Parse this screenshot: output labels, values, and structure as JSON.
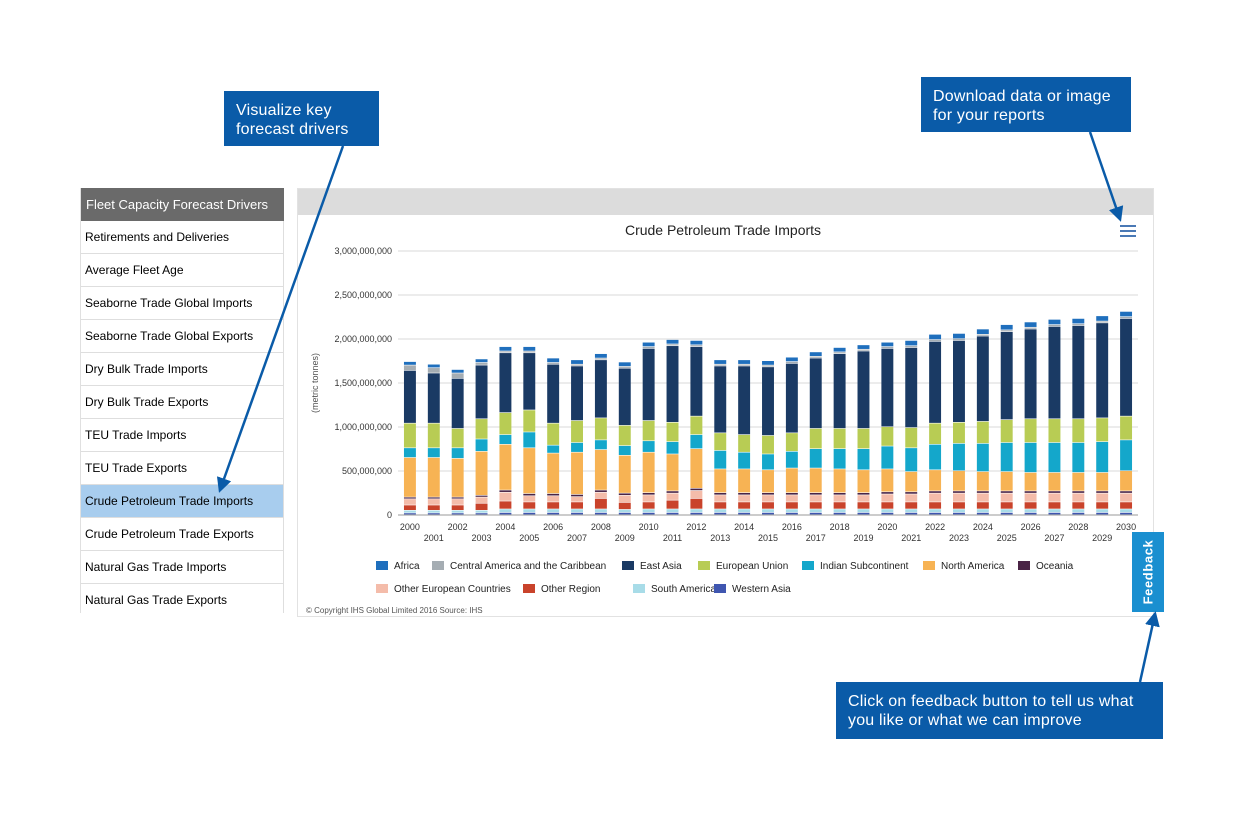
{
  "callouts": {
    "drivers": "Visualize key forecast drivers",
    "download": "Download data or image for your reports",
    "feedback": "Click on feedback button to tell us what you like or what we can improve"
  },
  "sidebar": {
    "header": "Fleet Capacity Forecast Drivers",
    "items": [
      {
        "label": "Retirements and Deliveries"
      },
      {
        "label": "Average Fleet Age"
      },
      {
        "label": "Seaborne Trade Global Imports"
      },
      {
        "label": "Seaborne Trade Global Exports"
      },
      {
        "label": "Dry Bulk Trade Imports"
      },
      {
        "label": "Dry Bulk Trade Exports"
      },
      {
        "label": "TEU Trade Imports"
      },
      {
        "label": "TEU Trade Exports"
      },
      {
        "label": "Crude Petroleum Trade Imports",
        "active": true
      },
      {
        "label": "Crude Petroleum Trade Exports"
      },
      {
        "label": "Natural Gas Trade Imports"
      },
      {
        "label": "Natural Gas Trade Exports"
      }
    ]
  },
  "chart": {
    "menu_icon": "hamburger-menu-icon",
    "copyright": "© Copyright IHS Global Limited 2016     Source: IHS"
  },
  "feedback": {
    "label": "Feedback"
  },
  "chart_data": {
    "type": "bar",
    "stacked": true,
    "title": "Crude Petroleum Trade Imports",
    "xlabel": "",
    "ylabel": "(metric tonnes)",
    "ylim": [
      0,
      3000000000
    ],
    "yticks": [
      "0",
      "500,000,000",
      "1,000,000,000",
      "1,500,000,000",
      "2,000,000,000",
      "2,500,000,000",
      "3,000,000,000"
    ],
    "grid": true,
    "legend": "bottom",
    "categories": [
      "2000",
      "2001",
      "2002",
      "2003",
      "2004",
      "2005",
      "2006",
      "2007",
      "2008",
      "2009",
      "2010",
      "2011",
      "2012",
      "2013",
      "2014",
      "2015",
      "2016",
      "2017",
      "2018",
      "2019",
      "2020",
      "2021",
      "2022",
      "2023",
      "2024",
      "2025",
      "2026",
      "2027",
      "2028",
      "2029",
      "2030"
    ],
    "series": [
      {
        "name": "Western Asia",
        "color": "#3f56b0",
        "values": [
          20,
          20,
          20,
          20,
          25,
          25,
          25,
          25,
          25,
          25,
          25,
          25,
          25,
          25,
          25,
          25,
          25,
          25,
          25,
          25,
          25,
          25,
          25,
          25,
          25,
          25,
          25,
          25,
          25,
          25,
          25
        ]
      },
      {
        "name": "South America",
        "color": "#a8dce8",
        "values": [
          30,
          30,
          30,
          30,
          40,
          40,
          40,
          40,
          40,
          35,
          40,
          40,
          40,
          40,
          40,
          40,
          40,
          40,
          40,
          40,
          40,
          40,
          40,
          40,
          40,
          40,
          40,
          40,
          40,
          40,
          40
        ]
      },
      {
        "name": "Other Region",
        "color": "#c9432b",
        "values": [
          60,
          60,
          60,
          80,
          90,
          80,
          80,
          80,
          120,
          80,
          80,
          100,
          120,
          80,
          80,
          80,
          80,
          80,
          80,
          80,
          80,
          80,
          80,
          80,
          80,
          80,
          80,
          80,
          80,
          80,
          80
        ]
      },
      {
        "name": "Other European Countries",
        "color": "#f4bcaa",
        "values": [
          70,
          70,
          70,
          70,
          100,
          70,
          70,
          60,
          70,
          80,
          80,
          80,
          90,
          80,
          80,
          80,
          80,
          80,
          80,
          80,
          90,
          90,
          100,
          100,
          100,
          100,
          100,
          100,
          100,
          100,
          100
        ]
      },
      {
        "name": "Oceania",
        "color": "#4a2446",
        "values": [
          20,
          20,
          20,
          20,
          25,
          25,
          25,
          25,
          25,
          25,
          25,
          25,
          25,
          25,
          25,
          25,
          25,
          25,
          25,
          25,
          25,
          25,
          25,
          25,
          25,
          25,
          25,
          25,
          25,
          25,
          25
        ]
      },
      {
        "name": "North America",
        "color": "#f7b354",
        "values": [
          450,
          450,
          440,
          500,
          520,
          520,
          460,
          480,
          460,
          430,
          460,
          420,
          450,
          270,
          270,
          260,
          280,
          280,
          270,
          260,
          260,
          230,
          240,
          230,
          220,
          220,
          210,
          210,
          210,
          210,
          230
        ]
      },
      {
        "name": "Indian Subcontinent",
        "color": "#14a7cb",
        "values": [
          110,
          110,
          120,
          140,
          110,
          180,
          90,
          110,
          110,
          110,
          130,
          140,
          160,
          210,
          190,
          180,
          190,
          220,
          230,
          240,
          260,
          270,
          290,
          310,
          320,
          330,
          340,
          340,
          340,
          350,
          350
        ]
      },
      {
        "name": "European Union",
        "color": "#b8cc54",
        "values": [
          280,
          280,
          220,
          230,
          250,
          250,
          250,
          250,
          250,
          230,
          230,
          220,
          210,
          200,
          200,
          210,
          210,
          230,
          230,
          230,
          220,
          230,
          240,
          240,
          250,
          260,
          270,
          270,
          270,
          270,
          270
        ]
      },
      {
        "name": "East Asia",
        "color": "#1a3a64",
        "values": [
          600,
          570,
          570,
          610,
          680,
          650,
          670,
          620,
          660,
          650,
          820,
          870,
          790,
          760,
          780,
          780,
          790,
          800,
          850,
          880,
          890,
          910,
          930,
          930,
          970,
          1000,
          1020,
          1050,
          1060,
          1080,
          1110
        ]
      },
      {
        "name": "Central America and the Caribbean",
        "color": "#a5adb3",
        "values": [
          60,
          60,
          60,
          30,
          20,
          20,
          20,
          20,
          20,
          20,
          20,
          20,
          20,
          20,
          20,
          20,
          20,
          20,
          20,
          20,
          20,
          20,
          20,
          20,
          20,
          20,
          20,
          20,
          20,
          20,
          20
        ]
      },
      {
        "name": "Africa",
        "color": "#1f6fbd",
        "values": [
          40,
          40,
          40,
          40,
          50,
          50,
          50,
          50,
          50,
          50,
          50,
          50,
          50,
          50,
          50,
          50,
          50,
          50,
          50,
          50,
          50,
          60,
          60,
          60,
          60,
          60,
          60,
          60,
          60,
          60,
          60
        ]
      }
    ],
    "value_scale": 1000000,
    "legend_order": [
      "Africa",
      "Central America and the Caribbean",
      "East Asia",
      "European Union",
      "Indian Subcontinent",
      "North America",
      "Oceania",
      "Other European Countries",
      "Other Region",
      "South America",
      "Western Asia"
    ]
  }
}
